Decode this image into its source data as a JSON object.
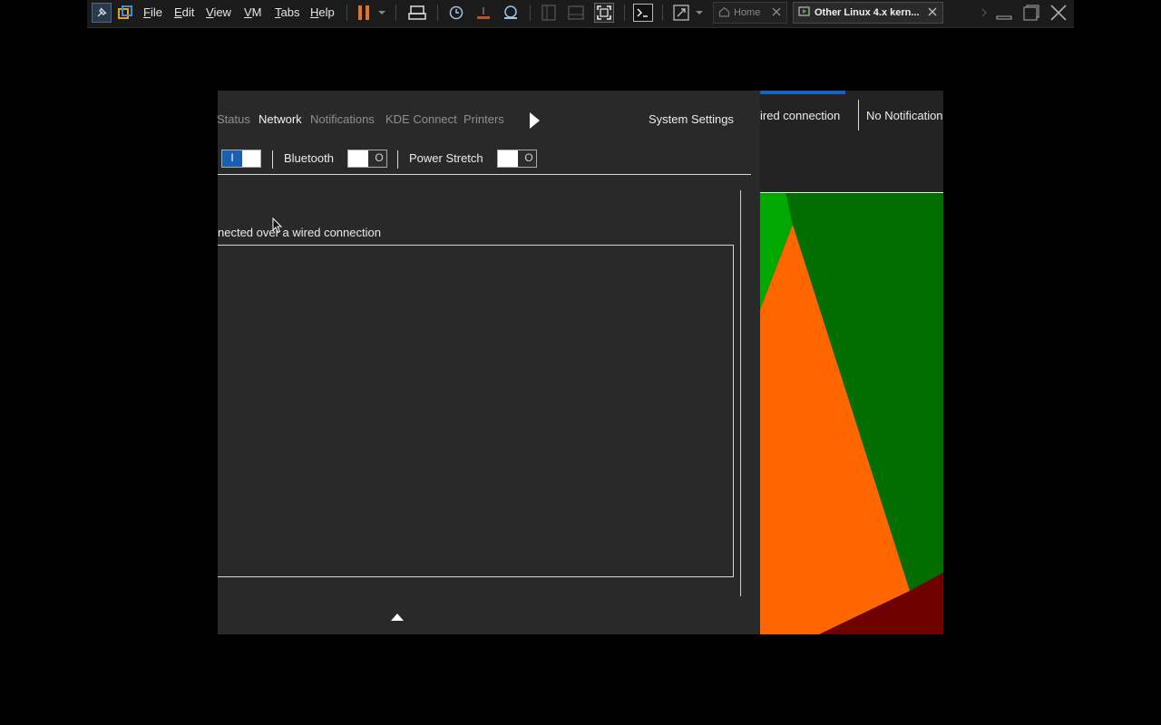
{
  "toolbar": {
    "menus": [
      "File",
      "Edit",
      "View",
      "VM",
      "Tabs",
      "Help"
    ],
    "icons": [
      "pin-icon",
      "library-icon",
      "pause-icon",
      "dropdown-icon",
      "send-keys-icon",
      "snapshot-icon",
      "revert-icon",
      "snapshot-manager-icon",
      "sidebar-icon",
      "thumbnail-icon",
      "fullscreen-icon",
      "console-icon",
      "stretch-icon",
      "close-icon",
      "minimize-icon",
      "restore-icon"
    ],
    "tabs": [
      {
        "label": "Home",
        "active": false
      },
      {
        "label": "Other Linux 4.x kern...",
        "active": true
      }
    ],
    "accent_color": "#e8731c"
  },
  "popup": {
    "tabs": [
      {
        "label": "Status",
        "active": false
      },
      {
        "label": "Network",
        "active": true
      },
      {
        "label": "Notifications",
        "active": false
      },
      {
        "label": "KDE Connect",
        "active": false
      },
      {
        "label": "Printers",
        "active": false
      }
    ],
    "system_settings": "System Settings",
    "toggles": [
      {
        "label": "",
        "state": "I",
        "on": true
      },
      {
        "label": "Bluetooth",
        "state": "O",
        "on": false
      },
      {
        "label": "Power Stretch",
        "state": "O",
        "on": false
      }
    ],
    "status_text": "nected over a wired connection",
    "switch_on_color": "#1a5fb4"
  },
  "panel": {
    "wired": "ired connection",
    "notifications": "No Notification"
  },
  "wallpaper_colors": [
    "#006e00",
    "#00a800",
    "#ff6600",
    "#6e0000"
  ]
}
